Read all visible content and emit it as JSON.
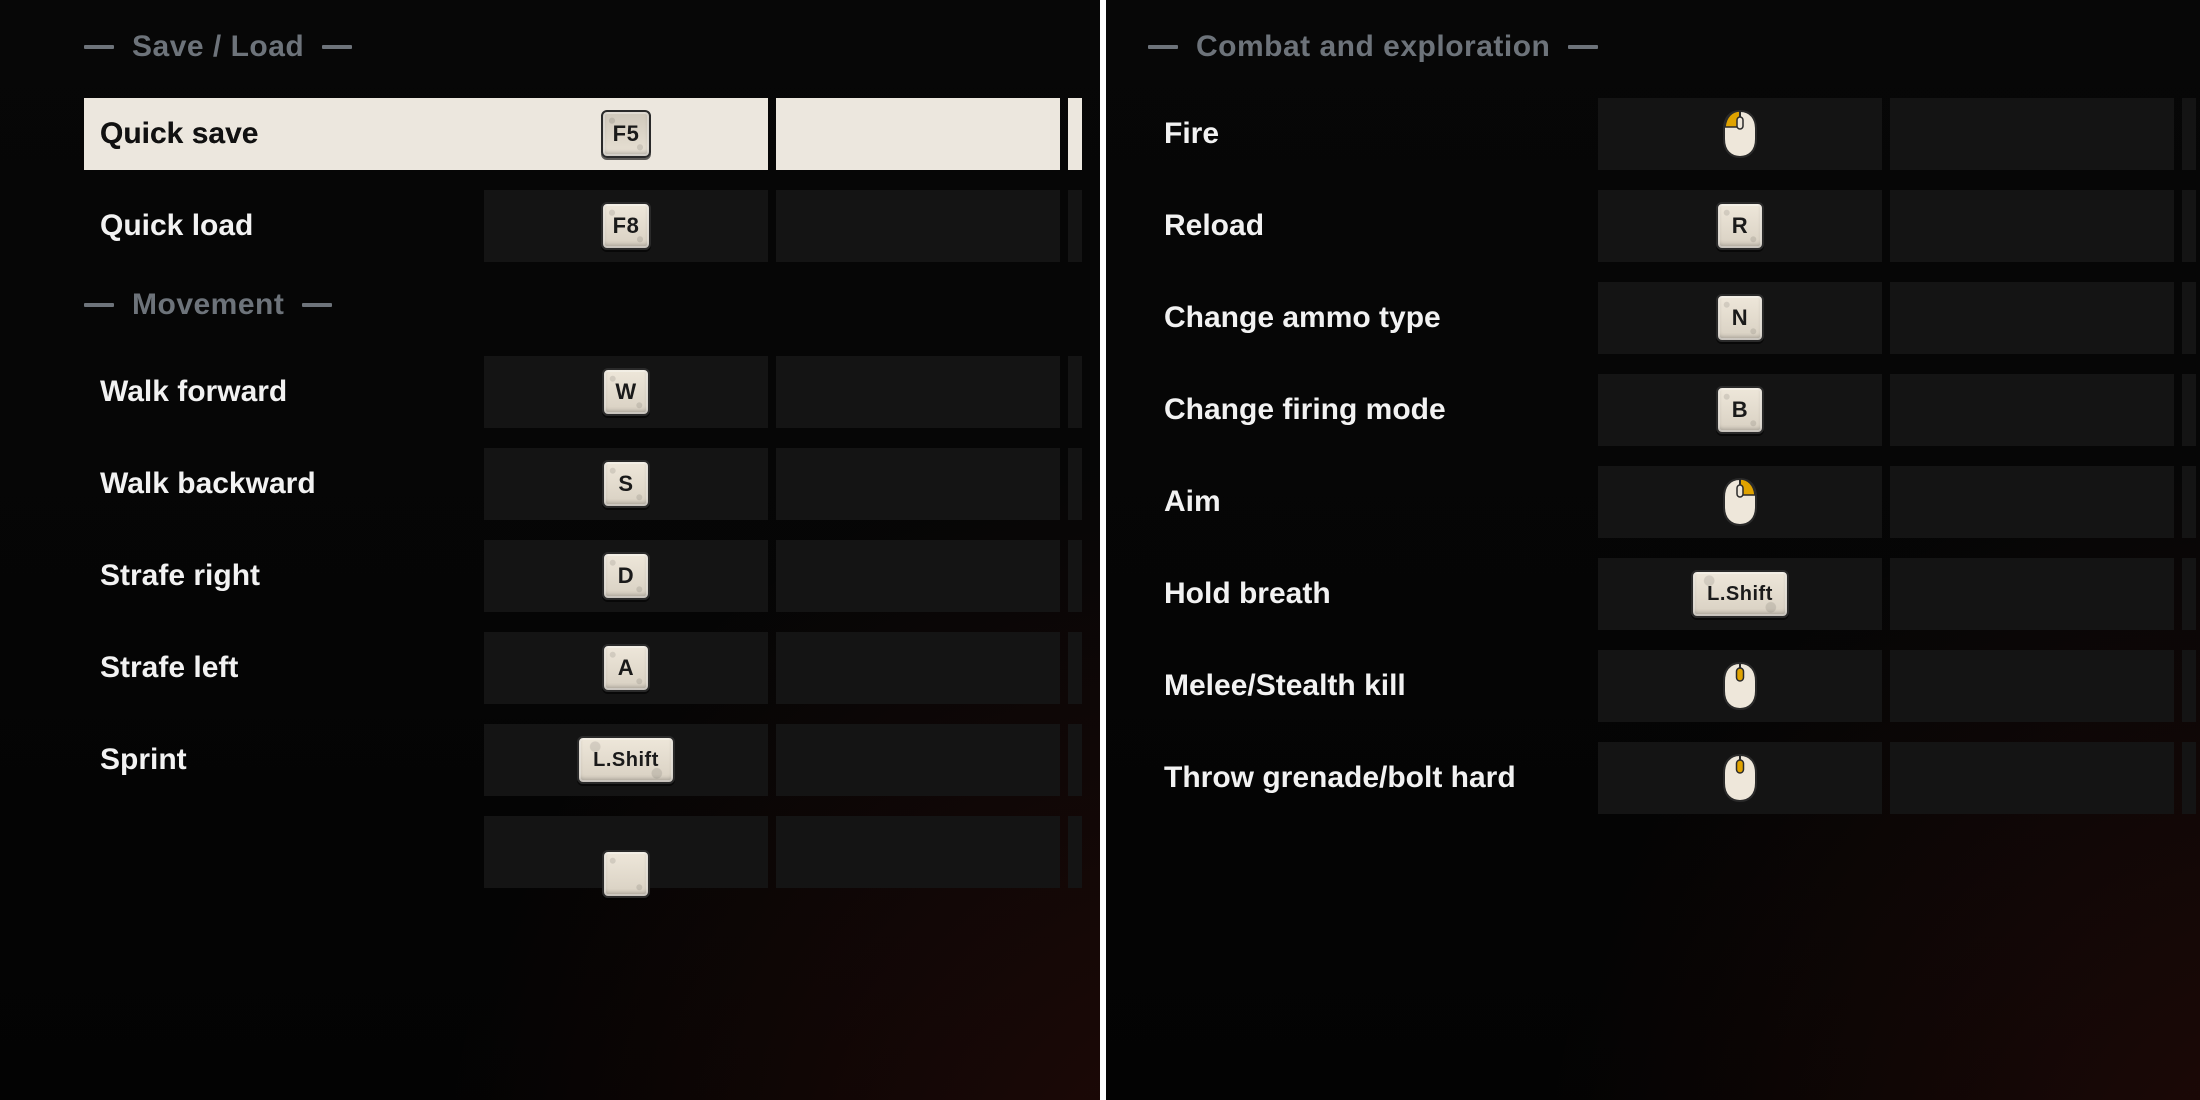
{
  "left": {
    "sections": [
      {
        "title": "Save / Load",
        "rows": [
          {
            "label": "Quick save",
            "key": "F5",
            "keyStyle": "small",
            "selected": true
          },
          {
            "label": "Quick load",
            "key": "F8",
            "keyStyle": "small"
          }
        ]
      },
      {
        "title": "Movement",
        "rows": [
          {
            "label": "Walk forward",
            "key": "W"
          },
          {
            "label": "Walk backward",
            "key": "S"
          },
          {
            "label": "Strafe right",
            "key": "D"
          },
          {
            "label": "Strafe left",
            "key": "A"
          },
          {
            "label": "Sprint",
            "key": "L.Shift",
            "keyStyle": "wide"
          }
        ]
      }
    ]
  },
  "right": {
    "sections": [
      {
        "title": "Combat and exploration",
        "rows": [
          {
            "label": "Fire",
            "mouse": "left"
          },
          {
            "label": "Reload",
            "key": "R"
          },
          {
            "label": "Change ammo type",
            "key": "N"
          },
          {
            "label": "Change firing mode",
            "key": "B"
          },
          {
            "label": "Aim",
            "mouse": "right"
          },
          {
            "label": "Hold breath",
            "key": "L.Shift",
            "keyStyle": "wide"
          },
          {
            "label": "Melee/Stealth kill",
            "mouse": "middle"
          },
          {
            "label": "Throw grenade/bolt hard",
            "mouse": "middle"
          }
        ]
      }
    ]
  }
}
